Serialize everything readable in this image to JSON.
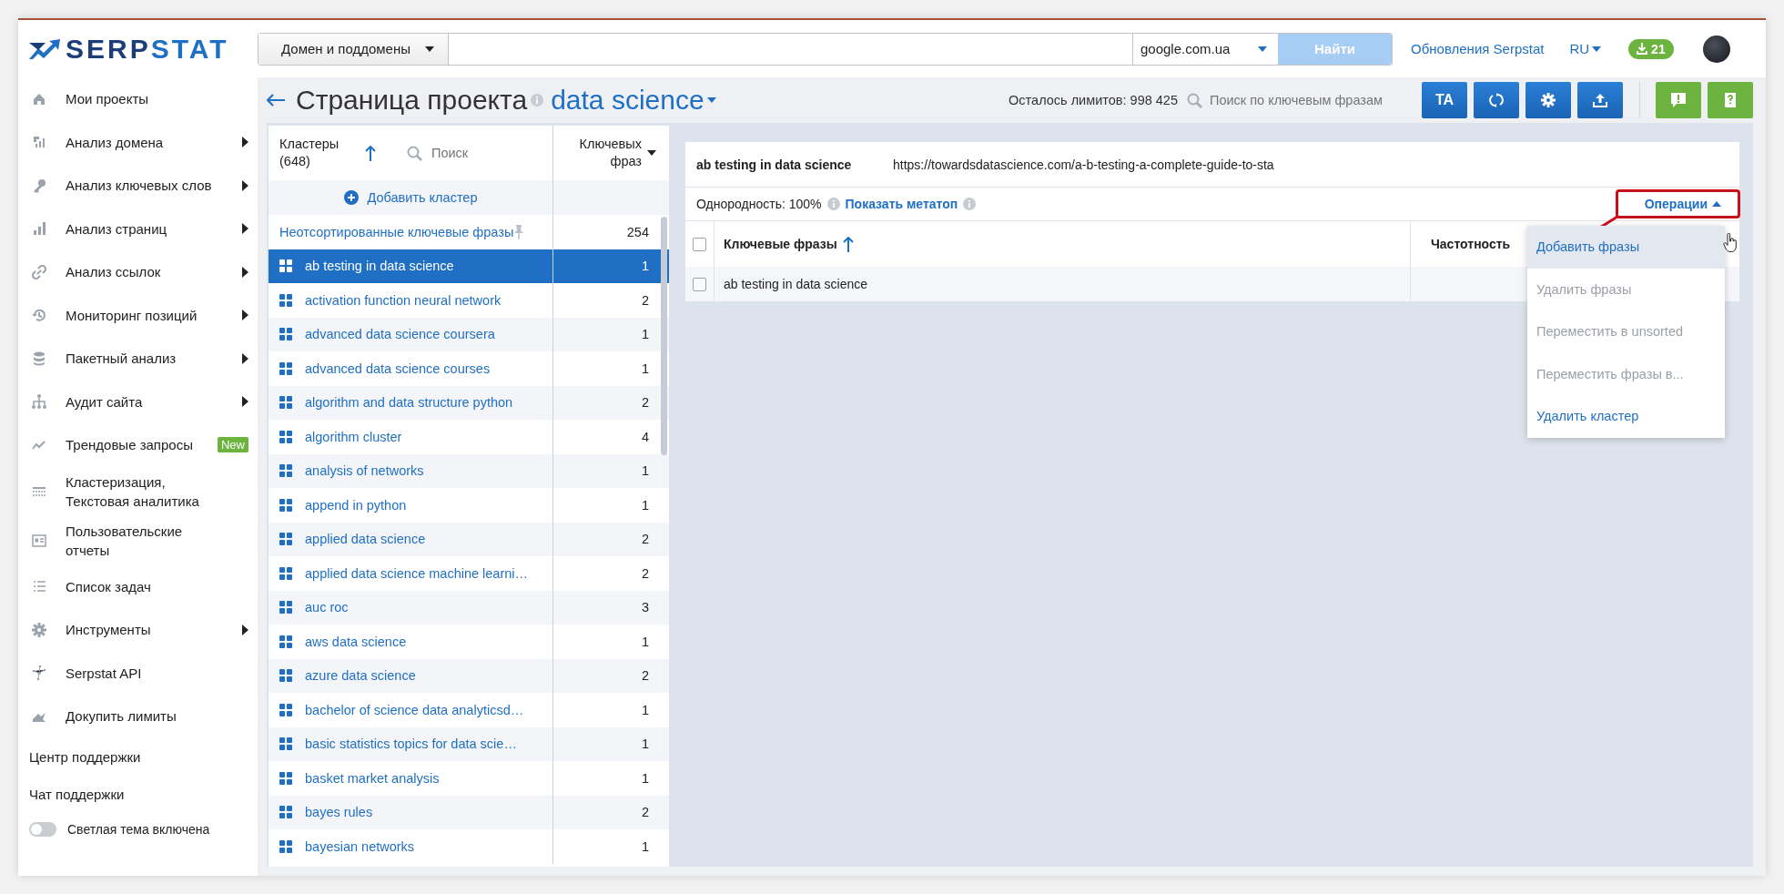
{
  "logo": {
    "parts": [
      "SERP",
      "STAT"
    ]
  },
  "search": {
    "mode": "Домен и поддомены",
    "engine": "google.com.ua",
    "button": "Найти",
    "button_disabled": true
  },
  "header": {
    "updates": "Обновления Serpstat",
    "language": "RU",
    "downloads": "21"
  },
  "sidebar": {
    "items": [
      {
        "kind": "home",
        "label": "Мои проекты",
        "submenu": false
      },
      {
        "kind": "domain",
        "label": "Анализ домена",
        "submenu": true
      },
      {
        "kind": "key",
        "label": "Анализ ключевых слов",
        "submenu": true
      },
      {
        "kind": "pages",
        "label": "Анализ страниц",
        "submenu": true
      },
      {
        "kind": "links",
        "label": "Анализ ссылок",
        "submenu": true
      },
      {
        "kind": "monitoring",
        "label": "Мониторинг позиций",
        "submenu": true
      },
      {
        "kind": "batch",
        "label": "Пакетный анализ",
        "submenu": true
      },
      {
        "kind": "audit",
        "label": "Аудит сайта",
        "submenu": true
      },
      {
        "kind": "trends",
        "label": "Трендовые запросы",
        "submenu": false,
        "badge": "New"
      },
      {
        "kind": "clustering",
        "label": "Кластеризация, Текстовая аналитика",
        "submenu": false
      },
      {
        "kind": "reports",
        "label": "Пользовательские отчеты",
        "submenu": false
      },
      {
        "kind": "tasks",
        "label": "Список задач",
        "submenu": false
      },
      {
        "kind": "tools",
        "label": "Инструменты",
        "submenu": true
      },
      {
        "kind": "api",
        "label": "Serpstat API",
        "submenu": false
      },
      {
        "kind": "limits",
        "label": "Докупить лимиты",
        "submenu": false
      }
    ],
    "links": [
      "Центр поддержки",
      "Чат поддержки"
    ],
    "theme_toggle": {
      "label": "Светлая тема включена",
      "on": false
    }
  },
  "page": {
    "title": "Страница проекта",
    "project": "data science",
    "limits": "Осталось лимитов: 998 425",
    "search_placeholder": "Поиск по ключевым фразам",
    "actions": [
      {
        "kind": "text",
        "label": "TA"
      },
      {
        "kind": "refresh"
      },
      {
        "kind": "settings"
      },
      {
        "kind": "export"
      }
    ],
    "feedback": [
      {
        "kind": "alert"
      },
      {
        "kind": "help"
      }
    ]
  },
  "clusters": {
    "title": "Кластеры (648)",
    "search_placeholder": "Поиск",
    "count_column": "Ключевых фраз",
    "add": "Добавить кластер",
    "unsorted": {
      "label": "Неотсортированные ключевые фразы",
      "count": "254"
    },
    "rows": [
      {
        "name": "ab testing in data science",
        "count": "1",
        "selected": true
      },
      {
        "name": "activation function neural network",
        "count": "2",
        "selected": false
      },
      {
        "name": "advanced data science coursera",
        "count": "1",
        "selected": false
      },
      {
        "name": "advanced data science courses",
        "count": "1",
        "selected": false
      },
      {
        "name": "algorithm and data structure python",
        "count": "2",
        "selected": false
      },
      {
        "name": "algorithm cluster",
        "count": "4",
        "selected": false
      },
      {
        "name": "analysis of networks",
        "count": "1",
        "selected": false
      },
      {
        "name": "append in python",
        "count": "1",
        "selected": false
      },
      {
        "name": "applied data science",
        "count": "2",
        "selected": false
      },
      {
        "name": "applied data science machine learni…",
        "count": "2",
        "selected": false
      },
      {
        "name": "auc roc",
        "count": "3",
        "selected": false
      },
      {
        "name": "aws data science",
        "count": "1",
        "selected": false
      },
      {
        "name": "azure data science",
        "count": "2",
        "selected": false
      },
      {
        "name": "bachelor of science data analyticsd…",
        "count": "1",
        "selected": false
      },
      {
        "name": "basic statistics topics for data scie…",
        "count": "1",
        "selected": false
      },
      {
        "name": "basket market analysis",
        "count": "1",
        "selected": false
      },
      {
        "name": "bayes rules",
        "count": "2",
        "selected": false
      },
      {
        "name": "bayesian networks",
        "count": "1",
        "selected": false
      }
    ]
  },
  "cluster": {
    "name": "ab testing in data science",
    "url": "https://towardsdatascience.com/a-b-testing-a-complete-guide-to-sta",
    "homogeneity": "Однородность: 100%",
    "metatop": "Показать метатоп",
    "operations": "Операции",
    "columns": [
      "Ключевые фразы",
      "Частотность"
    ],
    "select_all": false,
    "rows": [
      {
        "phrase": "ab testing in data science",
        "checked": false
      }
    ],
    "menu": [
      {
        "label": "Добавить фразы",
        "selected": true,
        "disabled": false
      },
      {
        "label": "Удалить фразы",
        "selected": false,
        "disabled": true
      },
      {
        "label": "Переместить в unsorted",
        "selected": false,
        "disabled": true
      },
      {
        "label": "Переместить фразы в...",
        "selected": false,
        "disabled": true
      },
      {
        "label": "Удалить кластер",
        "selected": false,
        "disabled": false
      }
    ]
  }
}
